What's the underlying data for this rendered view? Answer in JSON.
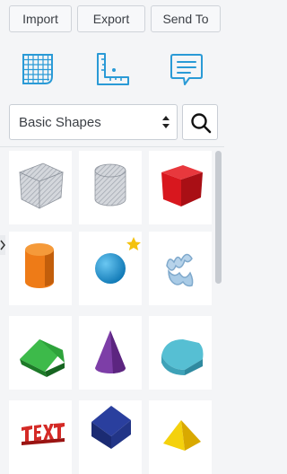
{
  "toolbar": {
    "import_label": "Import",
    "export_label": "Export",
    "send_to_label": "Send To"
  },
  "tools": [
    {
      "icon": "workplane-grid-icon"
    },
    {
      "icon": "ruler-icon"
    },
    {
      "icon": "notes-icon"
    }
  ],
  "library": {
    "selected_category": "Basic Shapes",
    "search_icon": "search-icon"
  },
  "shapes": [
    {
      "name": "box-hole"
    },
    {
      "name": "cylinder-hole"
    },
    {
      "name": "box"
    },
    {
      "name": "cylinder"
    },
    {
      "name": "sphere",
      "featured": true
    },
    {
      "name": "scribble"
    },
    {
      "name": "roof"
    },
    {
      "name": "cone"
    },
    {
      "name": "round-roof"
    },
    {
      "name": "text"
    },
    {
      "name": "prism"
    },
    {
      "name": "pyramid"
    }
  ],
  "colors": {
    "accent_blue": "#2a9ad6",
    "box_red": "#d8171e",
    "cylinder_orange": "#ee7b17",
    "sphere_blue": "#1593d3",
    "roof_green": "#2ea33b",
    "cone_purple": "#7d3ea7",
    "round_roof_teal": "#56bfd3",
    "star_gold": "#f4c20d"
  }
}
